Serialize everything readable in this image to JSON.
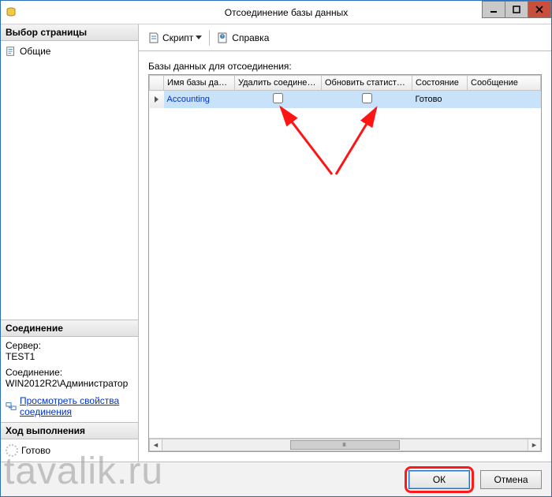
{
  "window": {
    "title": "Отсоединение базы данных"
  },
  "sidebar": {
    "page_select_hd": "Выбор страницы",
    "pages": {
      "general": "Общие"
    },
    "conn_hd": "Соединение",
    "conn_server_label": "Сервер:",
    "conn_server_value": "TEST1",
    "conn_login_label": "Соединение:",
    "conn_login_value": "WIN2012R2\\Администратор",
    "conn_view_link": "Просмотреть свойства соединения",
    "progress_hd": "Ход выполнения",
    "progress_state": "Готово"
  },
  "toolbar": {
    "script": "Скрипт",
    "help": "Справка"
  },
  "main": {
    "grid_title": "Базы данных для отсоединения:",
    "columns": {
      "row_handle": "",
      "db_name": "Имя базы данн...",
      "drop_conn": "Удалить соединения",
      "update_stats": "Обновить статистику",
      "state": "Состояние",
      "message": "Сообщение"
    },
    "rows": [
      {
        "db_name": "Accounting",
        "drop_conn": false,
        "update_stats": false,
        "state": "Готово",
        "message": ""
      }
    ]
  },
  "footer": {
    "ok": "ОК",
    "cancel": "Отмена"
  },
  "watermark": "tavalik.ru"
}
